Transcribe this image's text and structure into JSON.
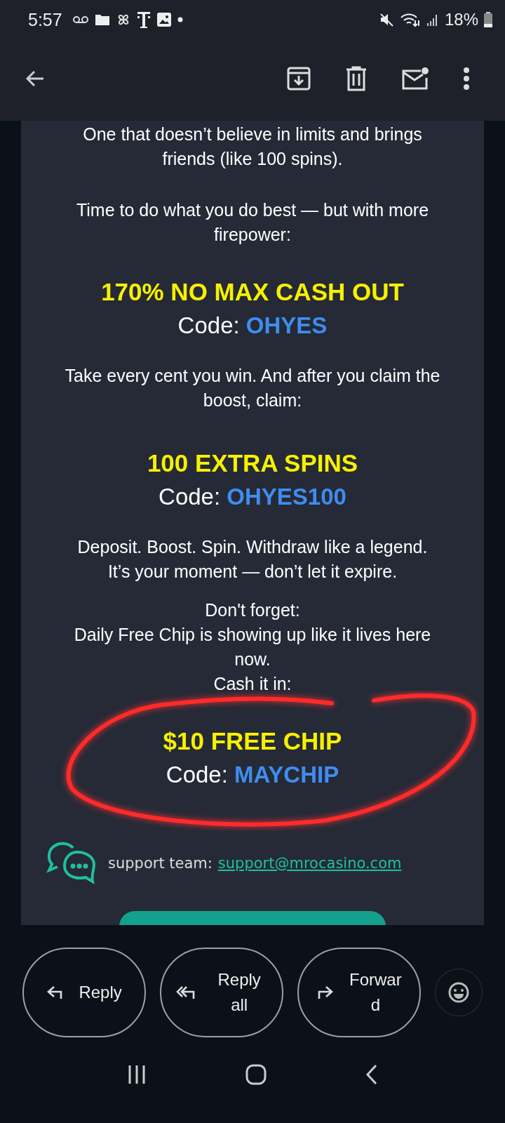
{
  "status_bar": {
    "time": "5:57",
    "battery": "18%"
  },
  "email": {
    "blocks": [
      {
        "kind": "paragraph",
        "text": "One that doesn’t believe in limits and brings friends (like 100 spins)."
      },
      {
        "kind": "paragraph",
        "text": "Time to do what you do best — but with more firepower:"
      },
      {
        "kind": "offer",
        "title": "170% NO MAX CASH OUT",
        "code_label": "Code:",
        "code": "OHYES"
      },
      {
        "kind": "paragraph",
        "text": "Take every cent you win. And after you claim the boost, claim:"
      },
      {
        "kind": "offer",
        "title": "100 EXTRA SPINS",
        "code_label": "Code:",
        "code": "OHYES100"
      },
      {
        "kind": "paragraph",
        "text": "Deposit. Boost. Spin. Withdraw like a legend.\nIt’s your moment — don’t let it expire."
      },
      {
        "kind": "paragraph",
        "text": "Don't forget:\nDaily Free Chip is showing up like it lives here now.\nCash it in:"
      },
      {
        "kind": "offer",
        "title": "$10 FREE CHIP",
        "code_label": "Code:",
        "code": "MAYCHIP",
        "circled": true
      }
    ],
    "support": {
      "label": "support team:",
      "email": "support@mrocasino.com"
    }
  },
  "actions": [
    {
      "kind": "reply",
      "label": "Reply"
    },
    {
      "kind": "reply_all",
      "label": "Reply all"
    },
    {
      "kind": "forward",
      "label": "Forward"
    }
  ]
}
